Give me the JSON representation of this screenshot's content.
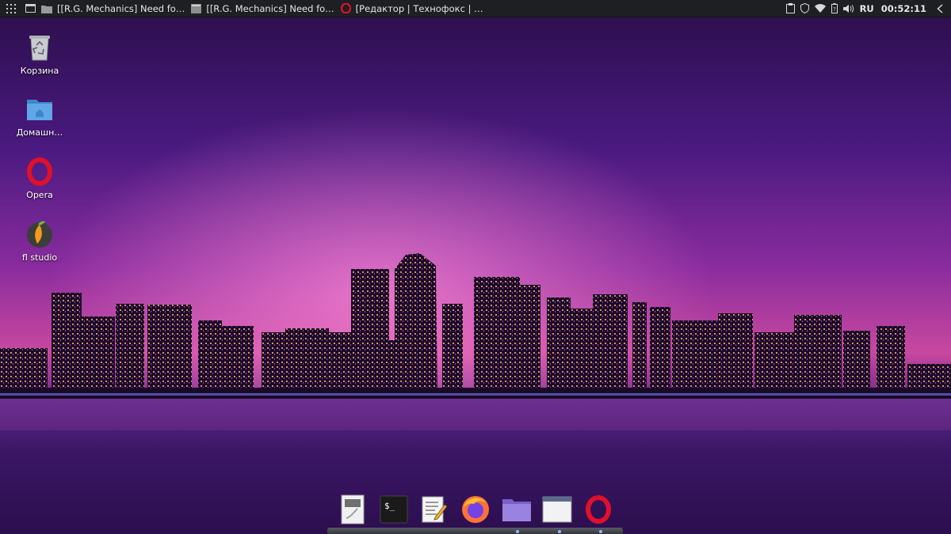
{
  "top_panel": {
    "tasks": [
      {
        "title": "[[R.G. Mechanics] Need fo…",
        "icon": "browser-window-icon"
      },
      {
        "title": "[[R.G. Mechanics] Need fo…",
        "icon": "game-window-icon"
      },
      {
        "title": "[Редактор | Технофокс | …",
        "icon": "opera-icon"
      }
    ],
    "tray": {
      "language": "RU",
      "clock": "00:52:11",
      "icons": [
        "clipboard-icon",
        "shield-icon",
        "wifi-icon",
        "battery-icon",
        "volume-icon",
        "collapse-arrow-icon"
      ]
    }
  },
  "desktop_icons": [
    {
      "label": "Корзина",
      "icon": "trash-icon"
    },
    {
      "label": "Домашн…",
      "icon": "home-folder-icon"
    },
    {
      "label": "Opera",
      "icon": "opera-icon"
    },
    {
      "label": "fl studio",
      "icon": "fl-studio-icon"
    }
  ],
  "dock": {
    "items": [
      "file-viewer-icon",
      "terminal-icon",
      "text-editor-icon",
      "firefox-icon",
      "files-icon",
      "window-icon",
      "opera-icon"
    ],
    "terminal_prompt": "$_"
  },
  "colors": {
    "panel_bg": "#1e1f22",
    "sky_top": "#2a0f4a",
    "sky_glow": "#d04fa3",
    "water": "#341259",
    "opera_red": "#e0102a"
  }
}
